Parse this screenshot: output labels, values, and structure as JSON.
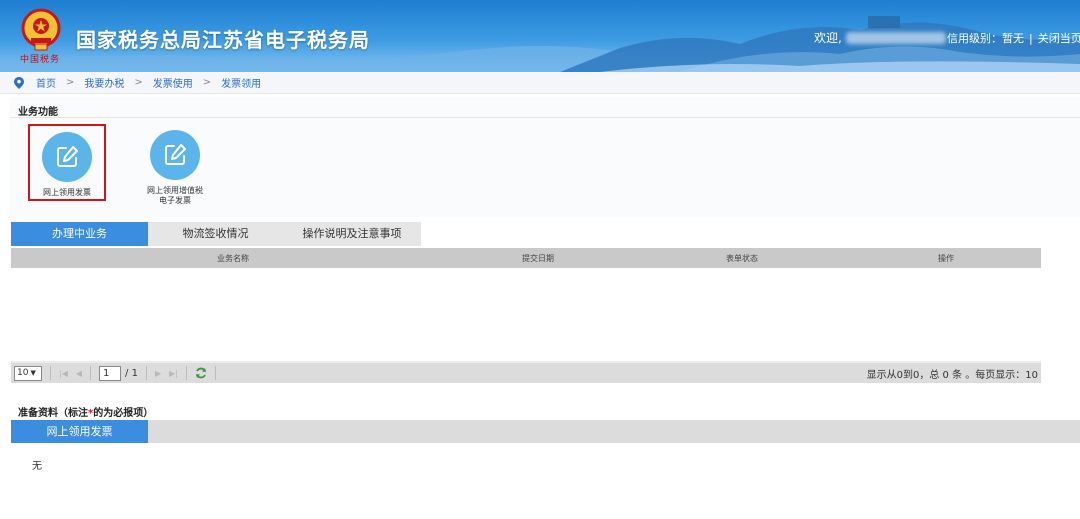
{
  "header": {
    "site_title": "国家税务总局江苏省电子税务局",
    "emblem_caption": "中国税务",
    "welcome": "欢迎,",
    "credit_level": "信用级别：暂无",
    "close_page": "关闭当页"
  },
  "breadcrumb": {
    "items": [
      "首页",
      "我要办税",
      "发票使用",
      "发票领用"
    ],
    "separator": ">"
  },
  "functions": {
    "title": "业务功能",
    "items": [
      {
        "label": "网上领用发票",
        "icon": "edit-icon",
        "selected": true
      },
      {
        "label": "网上领用增值税电子发票",
        "icon": "edit-icon",
        "selected": false
      }
    ]
  },
  "tabs": {
    "items": [
      "办理中业务",
      "物流签收情况",
      "操作说明及注意事项"
    ],
    "active": 0
  },
  "table": {
    "columns": [
      "业务名称",
      "提交日期",
      "表单状态",
      "操作"
    ],
    "rows": []
  },
  "pager": {
    "page_size": "10",
    "current_page": "1",
    "total_pages": "/ 1",
    "info": "显示从0到0，总 0 条 。每页显示：10"
  },
  "materials": {
    "title_prefix": "准备资料（标注",
    "required_mark": "*",
    "title_suffix": "的为必报项）",
    "tab": "网上领用发票",
    "content": "无"
  },
  "colors": {
    "accent": "#3b8de0",
    "header_blue": "#1e7fd0",
    "icon_circle": "#5bb5ea",
    "highlight_border": "#d0161d"
  }
}
